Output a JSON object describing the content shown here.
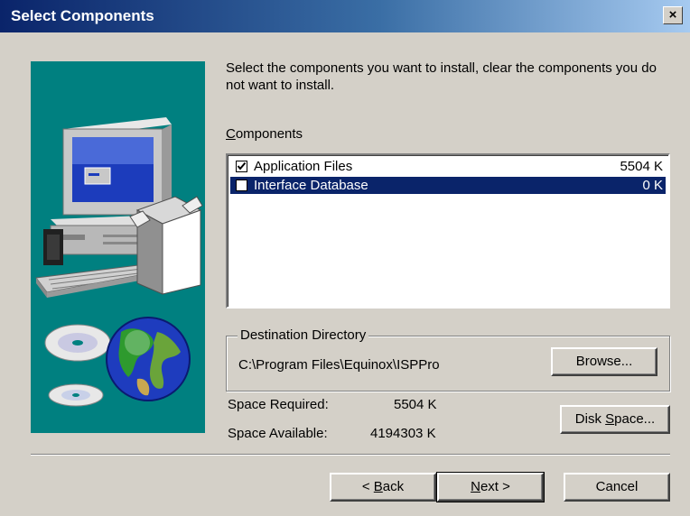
{
  "window": {
    "title": "Select Components",
    "close_label": "×"
  },
  "instruction": "Select the components you want to install, clear the components you do not want to install.",
  "components": {
    "label_prefix": "C",
    "label_rest": "omponents",
    "items": [
      {
        "label": "Application Files",
        "size": "5504 K",
        "checked": true
      },
      {
        "label": "Interface Database",
        "size": "0 K",
        "checked": false
      }
    ]
  },
  "destination": {
    "legend": "Destination Directory",
    "path": "C:\\Program Files\\Equinox\\ISPPro",
    "browse_label": "Browse..."
  },
  "space": {
    "required_label": "Space Required:",
    "required_value": "5504 K",
    "available_label": "Space Available:",
    "available_value": "4194303 K",
    "disk_space_prefix": "Disk ",
    "disk_space_hotkey": "S",
    "disk_space_rest": "pace..."
  },
  "buttons": {
    "back_prefix": "< ",
    "back_hotkey": "B",
    "back_rest": "ack",
    "next_hotkey": "N",
    "next_rest": "ext >",
    "cancel": "Cancel"
  },
  "colors": {
    "title_bar": "#0a246a",
    "illustration_bg": "#008080",
    "selection": "#0a246a",
    "dialog_bg": "#d4d0c8"
  }
}
